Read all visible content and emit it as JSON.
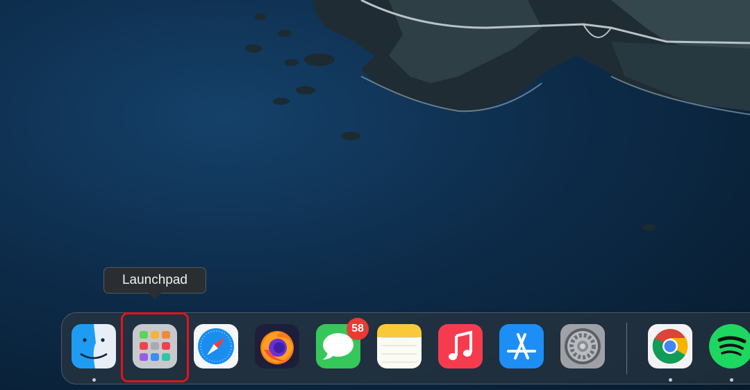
{
  "tooltip": {
    "label": "Launchpad"
  },
  "dock": {
    "items": [
      {
        "id": "finder",
        "icon": "finder-icon",
        "running": true
      },
      {
        "id": "launchpad",
        "icon": "launchpad-icon",
        "running": false,
        "highlighted": true
      },
      {
        "id": "safari",
        "icon": "safari-icon",
        "running": false
      },
      {
        "id": "firefox",
        "icon": "firefox-icon",
        "running": false
      },
      {
        "id": "messages",
        "icon": "messages-icon",
        "running": false,
        "badge": "58"
      },
      {
        "id": "notes",
        "icon": "notes-icon",
        "running": false
      },
      {
        "id": "music",
        "icon": "music-icon",
        "running": false
      },
      {
        "id": "app-store",
        "icon": "app-store-icon",
        "running": false
      },
      {
        "id": "system-preferences",
        "icon": "system-preferences-icon",
        "running": false
      },
      {
        "id": "chrome",
        "icon": "chrome-icon",
        "running": true
      },
      {
        "id": "spotify",
        "icon": "spotify-icon",
        "running": true
      }
    ]
  },
  "colors": {
    "highlight": "#e5131a",
    "badge": "#ea3b32"
  }
}
